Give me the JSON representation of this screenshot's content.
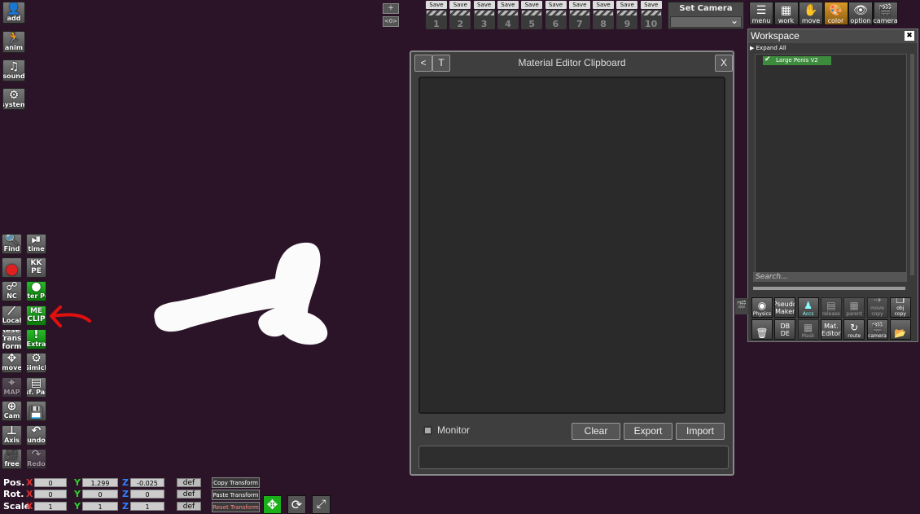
{
  "left_top": [
    {
      "name": "add-button",
      "label": "add",
      "icon": "person-icon",
      "glyph": "👤"
    },
    {
      "name": "anim-button",
      "label": "anim",
      "icon": "running-icon",
      "glyph": "🏃"
    },
    {
      "name": "sound-button",
      "label": "sound",
      "icon": "music-note-icon",
      "glyph": "♫"
    },
    {
      "name": "system-button",
      "label": "system",
      "icon": "gears-icon",
      "glyph": "⚙"
    }
  ],
  "left_tools": [
    {
      "name": "find-button",
      "label": "Find",
      "icon": "magnifier-icon",
      "glyph": "🔍",
      "style": ""
    },
    {
      "name": "time-button",
      "label": "time",
      "icon": "play-pause-icon",
      "glyph": "⏯",
      "style": ""
    },
    {
      "name": "rec-button",
      "label": "",
      "icon": "rec-icon",
      "glyph": "●",
      "style": ""
    },
    {
      "name": "kkpe-button",
      "label": "KK PE",
      "icon": "",
      "glyph": "",
      "style": ""
    },
    {
      "name": "nc-button",
      "label": "NC",
      "icon": "nodes-icon",
      "glyph": "☍",
      "style": ""
    },
    {
      "name": "center-point-button",
      "label": "Center Point",
      "icon": "dot-icon",
      "glyph": "●",
      "style": "green"
    },
    {
      "name": "local-button",
      "label": "Local",
      "icon": "axis-local-icon",
      "glyph": "⟋",
      "style": ""
    },
    {
      "name": "me-clip-button",
      "label": "ME CLIP",
      "icon": "",
      "glyph": "",
      "style": "green"
    },
    {
      "name": "reset-transform-button",
      "label": "Reset Trans-form",
      "icon": "",
      "glyph": "",
      "style": ""
    },
    {
      "name": "extra-button",
      "label": "Extra",
      "icon": "",
      "glyph": "!",
      "style": "green"
    },
    {
      "name": "move-button",
      "label": "move",
      "icon": "move-arrows-icon",
      "glyph": "✥",
      "style": ""
    },
    {
      "name": "gimick-button",
      "label": "Gimick",
      "icon": "gear-icon",
      "glyph": "⚙",
      "style": ""
    },
    {
      "name": "map-button",
      "label": "MAP",
      "icon": "map-icon",
      "glyph": "⌖",
      "style": "dim"
    },
    {
      "name": "transf-parallel-button",
      "label": "Transf. Parallel",
      "icon": "",
      "glyph": "▤",
      "style": ""
    },
    {
      "name": "cam-button",
      "label": "Cam",
      "icon": "plus-circle-icon",
      "glyph": "⊕",
      "style": ""
    },
    {
      "name": "save-scene-button",
      "label": "",
      "icon": "floppy-icon",
      "glyph": "💾",
      "style": ""
    },
    {
      "name": "axis-button",
      "label": "Axis",
      "icon": "axis-icon",
      "glyph": "⊥",
      "style": ""
    },
    {
      "name": "undo-button",
      "label": "undo",
      "icon": "undo-icon",
      "glyph": "↶",
      "style": ""
    },
    {
      "name": "free-button",
      "label": "free",
      "icon": "camera-icon",
      "glyph": "🎥",
      "style": ""
    },
    {
      "name": "redo-button",
      "label": "Redo",
      "icon": "redo-icon",
      "glyph": "↷",
      "style": "dim"
    }
  ],
  "zoom": {
    "plus": "+",
    "eye": "<0>"
  },
  "save_slots": [
    "1",
    "2",
    "3",
    "4",
    "5",
    "6",
    "7",
    "8",
    "9",
    "10"
  ],
  "save_label": "Save",
  "set_camera": "Set Camera",
  "top_menu": [
    {
      "name": "menu-button",
      "label": "menu",
      "icon": "list-icon",
      "glyph": "☰"
    },
    {
      "name": "work-button",
      "label": "work",
      "icon": "grid-icon",
      "glyph": "▦"
    },
    {
      "name": "move-menu-button",
      "label": "move",
      "icon": "hand-icon",
      "glyph": "✋"
    },
    {
      "name": "color-button",
      "label": "color",
      "icon": "palette-icon",
      "glyph": "🎨"
    },
    {
      "name": "option-button",
      "label": "option",
      "icon": "eye-icon",
      "glyph": "👁"
    },
    {
      "name": "camera-button",
      "label": "camera",
      "icon": "clapper-icon",
      "glyph": "🎬"
    }
  ],
  "material_editor": {
    "back": "<",
    "t": "T",
    "title": "Material Editor Clipboard",
    "close": "X",
    "monitor": "Monitor",
    "clear": "Clear",
    "export": "Export",
    "import": "Import"
  },
  "workspace": {
    "title": "Workspace",
    "close": "✖",
    "expand_all": "Expand All",
    "item": "Large Penis V2",
    "search_placeholder": "Search...",
    "buttons": [
      {
        "name": "physics-button",
        "label": "Physics",
        "glyph": "◉",
        "dim": false
      },
      {
        "name": "pseudo-maker-button",
        "label": "Pseudo Maker",
        "glyph": "",
        "dim": false
      },
      {
        "name": "accs-button",
        "label": "Accs",
        "glyph": "♟",
        "dim": false
      },
      {
        "name": "release-button",
        "label": "release",
        "glyph": "▤",
        "dim": true
      },
      {
        "name": "parent-button",
        "label": "parent",
        "glyph": "▦",
        "dim": true
      },
      {
        "name": "move-copy-button",
        "label": "move copy",
        "glyph": "⇢",
        "dim": true
      },
      {
        "name": "obj-copy-button",
        "label": "obj copy",
        "glyph": "❐",
        "dim": false
      },
      {
        "name": "delete-button",
        "label": "",
        "glyph": "🗑",
        "dim": false
      },
      {
        "name": "dbde-button",
        "label": "DB DE",
        "glyph": "",
        "dim": false
      },
      {
        "name": "mask-button",
        "label": "Mask",
        "glyph": "▦",
        "dim": true
      },
      {
        "name": "mat-editor-button",
        "label": "Mat. Editor",
        "glyph": "",
        "dim": false
      },
      {
        "name": "route-button",
        "label": "route",
        "glyph": "↻",
        "dim": false
      },
      {
        "name": "ws-camera-button",
        "label": "camera",
        "glyph": "🎬",
        "dim": false
      },
      {
        "name": "folder-button",
        "label": "",
        "glyph": "📂",
        "dim": false
      }
    ]
  },
  "transform": {
    "rows": [
      {
        "label": "Pos.",
        "x": "0",
        "y": "1.299",
        "z": "-0.025",
        "def": "def"
      },
      {
        "label": "Rot.",
        "x": "0",
        "y": "0",
        "z": "0",
        "def": "def"
      },
      {
        "label": "Scale",
        "x": "1",
        "y": "1",
        "z": "1",
        "def": "def"
      }
    ],
    "copy": "Copy Transform",
    "paste": "Paste Transform",
    "reset": "Reset Transform",
    "axis": {
      "x": "X",
      "y": "Y",
      "z": "Z"
    }
  }
}
